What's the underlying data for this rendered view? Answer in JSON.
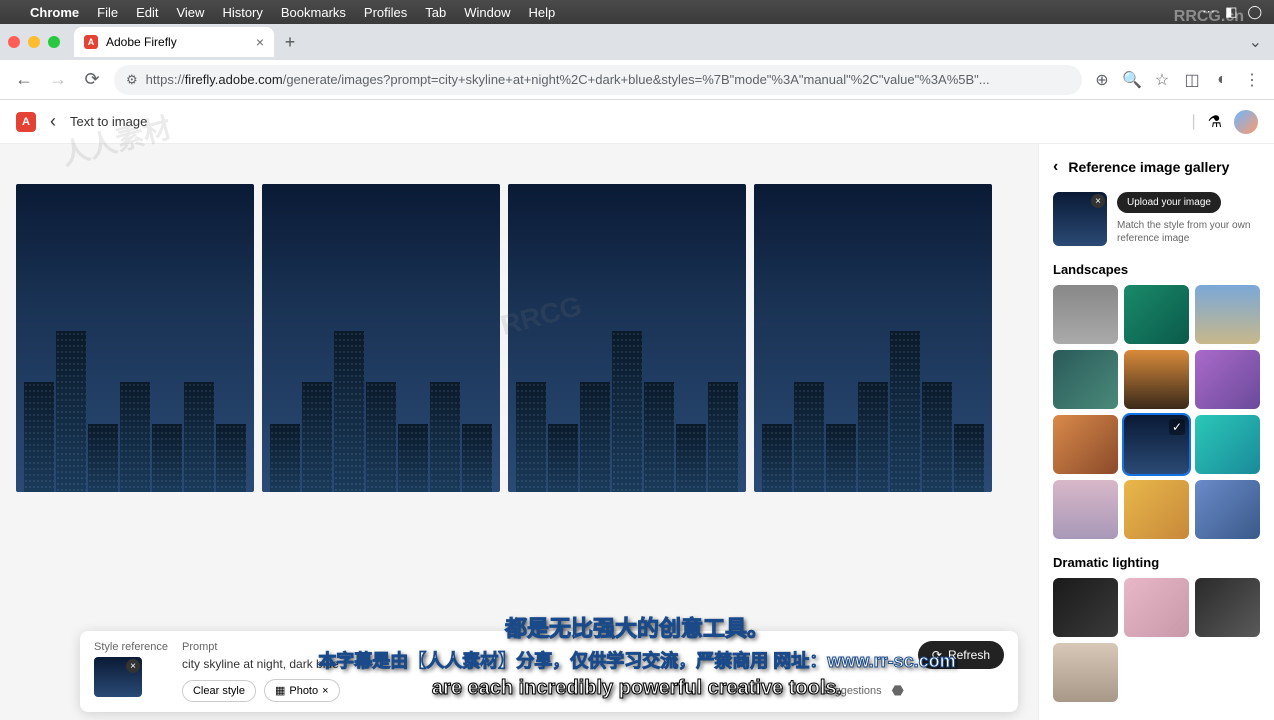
{
  "menubar": {
    "app": "Chrome",
    "items": [
      "File",
      "Edit",
      "View",
      "History",
      "Bookmarks",
      "Profiles",
      "Tab",
      "Window",
      "Help"
    ]
  },
  "tab": {
    "title": "Adobe Firefly"
  },
  "url": {
    "protocol": "https://",
    "domain": "firefly.adobe.com",
    "path": "/generate/images?prompt=city+skyline+at+night%2C+dark+blue&styles=%7B\"mode\"%3A\"manual\"%2C\"value\"%3A%5B\"..."
  },
  "app_header": {
    "title": "Text to image"
  },
  "sidebar": {
    "title": "Reference image gallery",
    "upload_button": "Upload your image",
    "upload_help": "Match the style from your own reference image",
    "section_landscapes": "Landscapes",
    "section_dramatic": "Dramatic lighting"
  },
  "bottom": {
    "style_ref_label": "Style reference",
    "prompt_label": "Prompt",
    "prompt_text": "city skyline at night, dark blue",
    "clear_style": "Clear style",
    "photo_tag": "Photo",
    "suggestions": "Suggestions",
    "refresh": "Refresh"
  },
  "subtitle": {
    "cn1": "都是无比强大的创意工具。",
    "cn2": "本字幕是由【人人素材】分享，仅供学习交流，严禁商用 网址：www.rr-sc.com",
    "en": "are each incredibly powerful creative tools."
  },
  "watermarks": [
    "RRCG",
    "人人素材",
    "RRCG.cn"
  ]
}
